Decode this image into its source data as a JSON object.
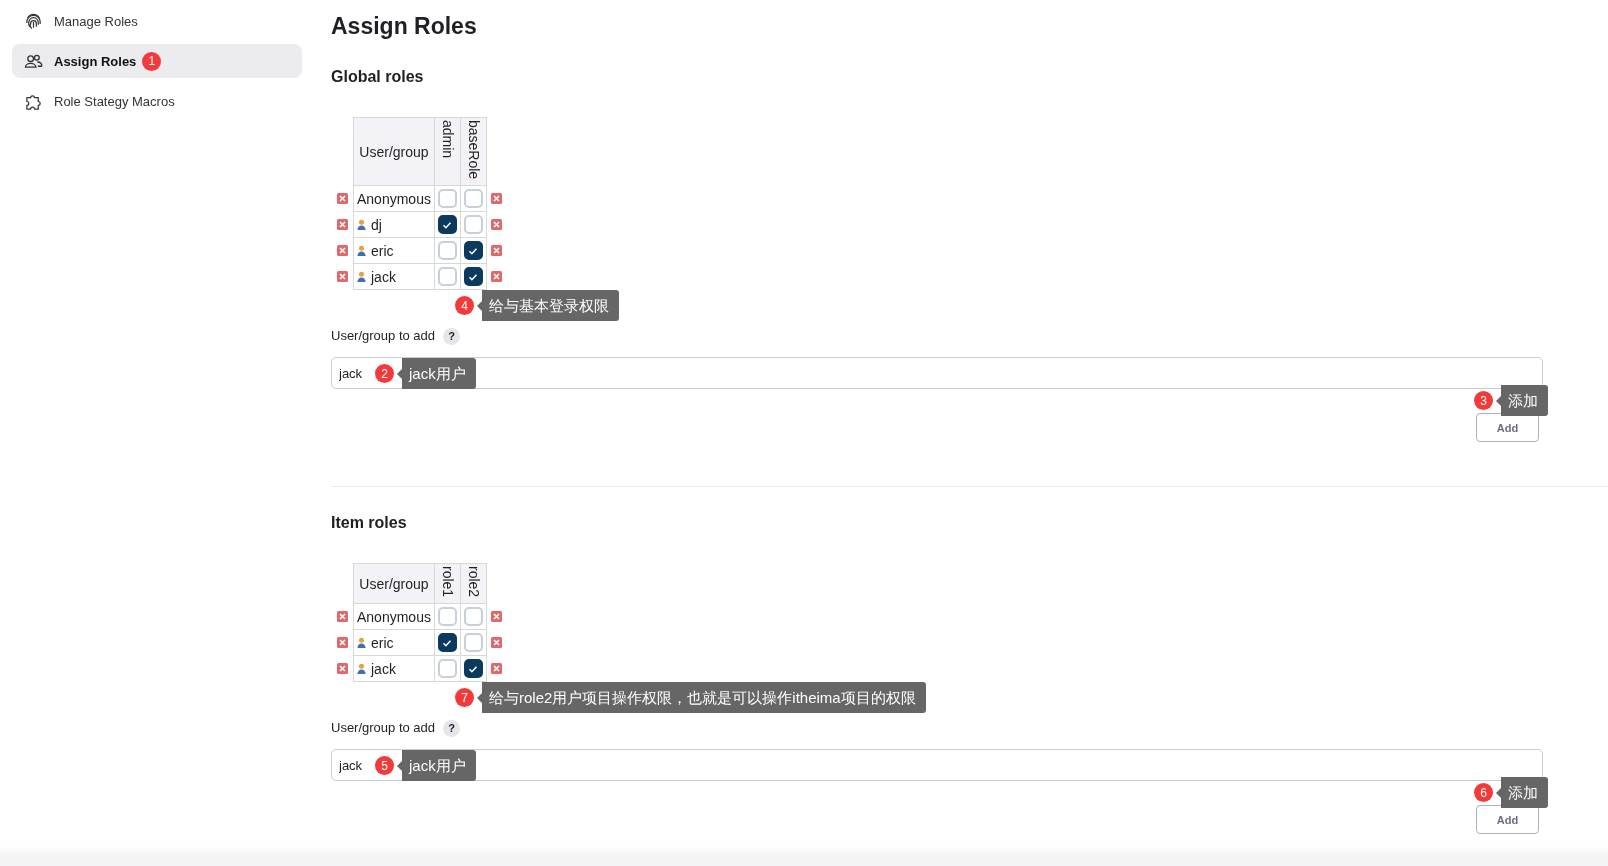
{
  "sidebar": {
    "items": [
      {
        "label": "Manage Roles",
        "selected": false
      },
      {
        "label": "Assign Roles",
        "selected": true,
        "note": "1"
      },
      {
        "label": "Role Stategy Macros",
        "selected": false
      }
    ]
  },
  "title": "Assign Roles",
  "sections": [
    {
      "heading": "Global roles",
      "table": {
        "header": "User/group",
        "roles": [
          "admin",
          "baseRole"
        ],
        "rows": [
          {
            "name": "Anonymous",
            "kind": "anonymous",
            "checks": [
              false,
              false
            ]
          },
          {
            "name": "dj",
            "kind": "user",
            "checks": [
              true,
              false
            ]
          },
          {
            "name": "eric",
            "kind": "user",
            "checks": [
              false,
              true
            ]
          },
          {
            "name": "jack",
            "kind": "user",
            "checks": [
              false,
              true
            ]
          }
        ]
      },
      "table_note": {
        "number": "4",
        "text": "给与基本登录权限"
      },
      "add": {
        "label": "User/group to add",
        "help": "?",
        "value": "jack",
        "note": {
          "number": "2",
          "text": "jack用户"
        },
        "button": "Add",
        "button_note": {
          "number": "3",
          "text": "添加"
        }
      }
    },
    {
      "heading": "Item roles",
      "table": {
        "header": "User/group",
        "roles": [
          "role1",
          "role2"
        ],
        "rows": [
          {
            "name": "Anonymous",
            "kind": "anonymous",
            "checks": [
              false,
              false
            ]
          },
          {
            "name": "eric",
            "kind": "user",
            "checks": [
              true,
              false
            ]
          },
          {
            "name": "jack",
            "kind": "user",
            "checks": [
              false,
              true
            ]
          }
        ]
      },
      "table_note": {
        "number": "7",
        "text": "给与role2用户项目操作权限，也就是可以操作itheima项目的权限"
      },
      "add": {
        "label": "User/group to add",
        "help": "?",
        "value": "jack",
        "note": {
          "number": "5",
          "text": "jack用户"
        },
        "button": "Add",
        "button_note": {
          "number": "6",
          "text": "添加"
        }
      }
    }
  ]
}
